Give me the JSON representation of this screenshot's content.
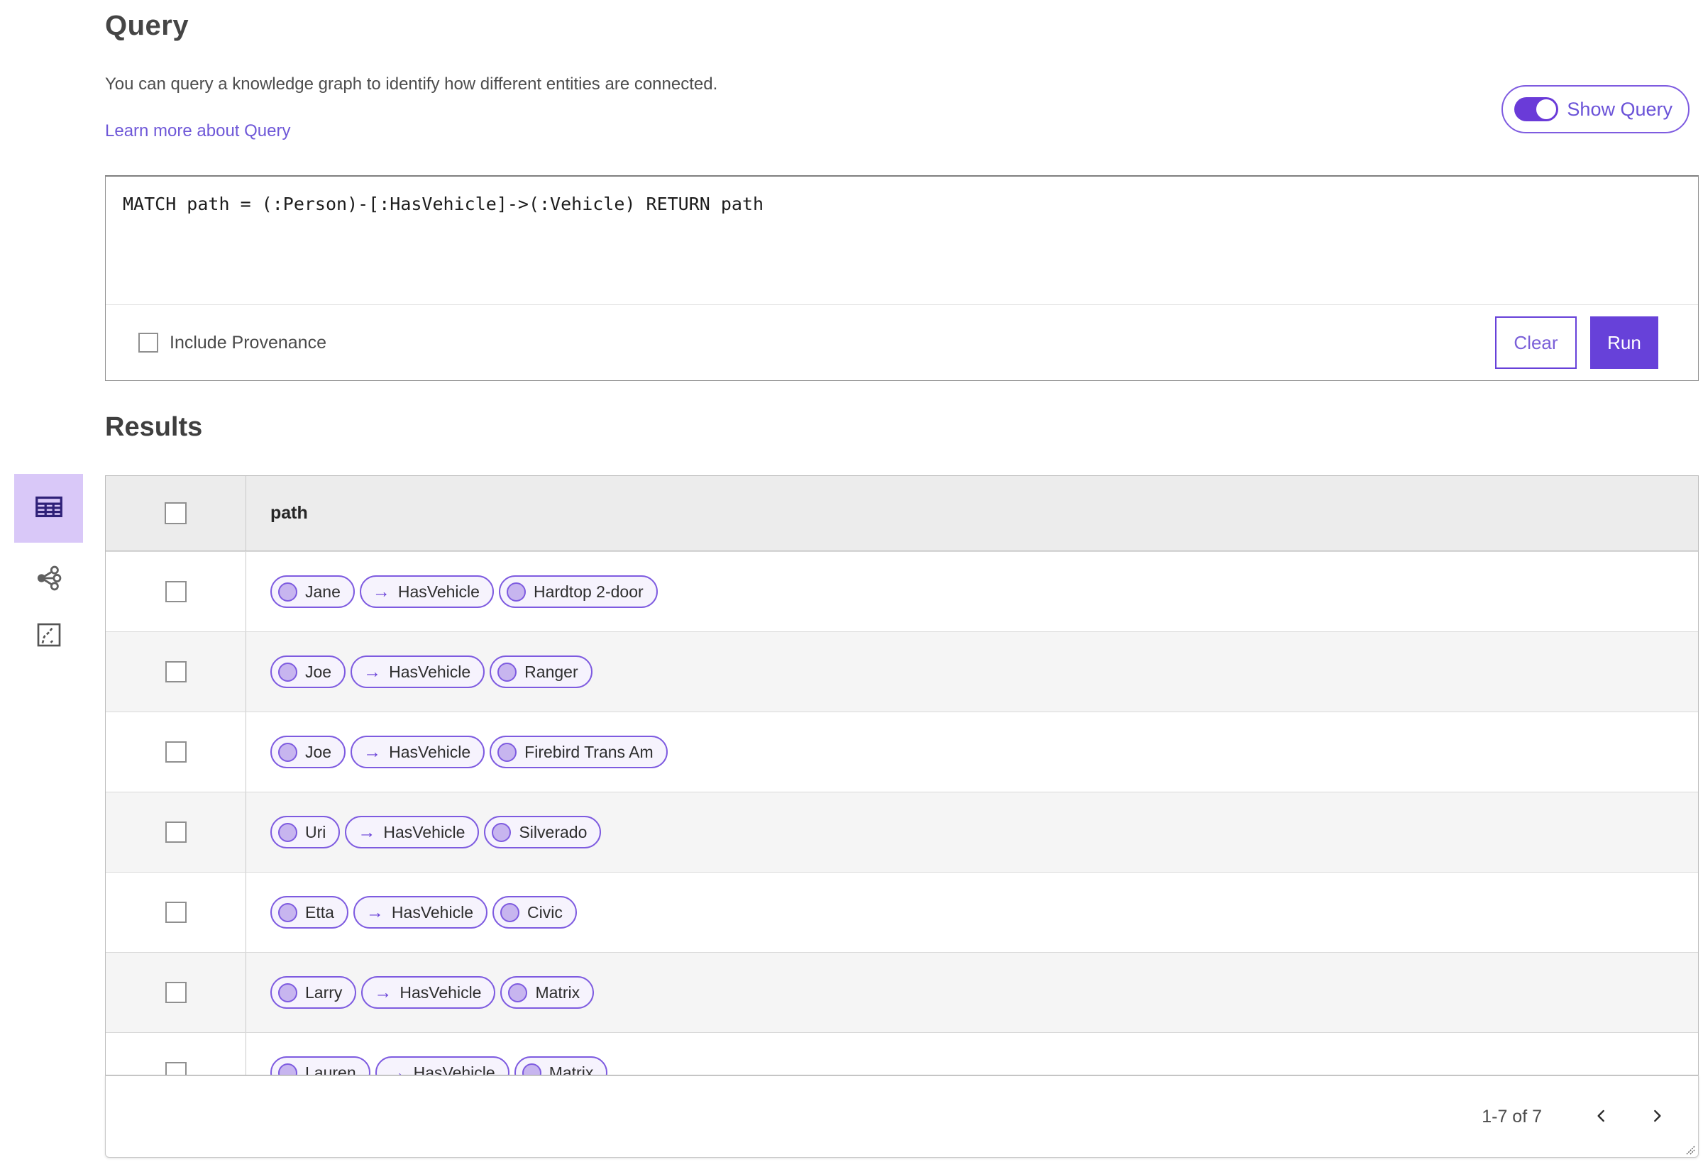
{
  "header": {
    "title": "Query",
    "description": "You can query a knowledge graph to identify how different entities are connected.",
    "learn_more_link": "Learn more about Query",
    "show_query_label": "Show Query",
    "show_query_on": true
  },
  "query_editor": {
    "query_text": "MATCH path = (:Person)-[:HasVehicle]->(:Vehicle) RETURN path",
    "include_provenance_label": "Include Provenance",
    "include_provenance_checked": false,
    "clear_label": "Clear",
    "run_label": "Run"
  },
  "results": {
    "title": "Results",
    "column_header": "path",
    "arrow": "→",
    "view_icons": [
      {
        "name": "table-view-icon",
        "selected": true
      },
      {
        "name": "link-chart-view-icon",
        "selected": false
      },
      {
        "name": "map-view-icon",
        "selected": false
      }
    ],
    "rows": [
      {
        "source": "Jane",
        "edge": "HasVehicle",
        "target": "Hardtop 2-door"
      },
      {
        "source": "Joe",
        "edge": "HasVehicle",
        "target": "Ranger"
      },
      {
        "source": "Joe",
        "edge": "HasVehicle",
        "target": "Firebird Trans Am"
      },
      {
        "source": "Uri",
        "edge": "HasVehicle",
        "target": "Silverado"
      },
      {
        "source": "Etta",
        "edge": "HasVehicle",
        "target": "Civic"
      },
      {
        "source": "Larry",
        "edge": "HasVehicle",
        "target": "Matrix"
      },
      {
        "source": "Lauren",
        "edge": "HasVehicle",
        "target": "Matrix"
      }
    ],
    "pagination": {
      "range_label": "1-7 of 7"
    }
  },
  "colors": {
    "accent": "#6741d9",
    "accent_light_tile": "#d9c8f8",
    "pill_border": "#7e5be0",
    "pill_fill": "#f6f3fd",
    "node_circle_fill": "#c7b5ef",
    "link_text": "#6f58d8"
  }
}
